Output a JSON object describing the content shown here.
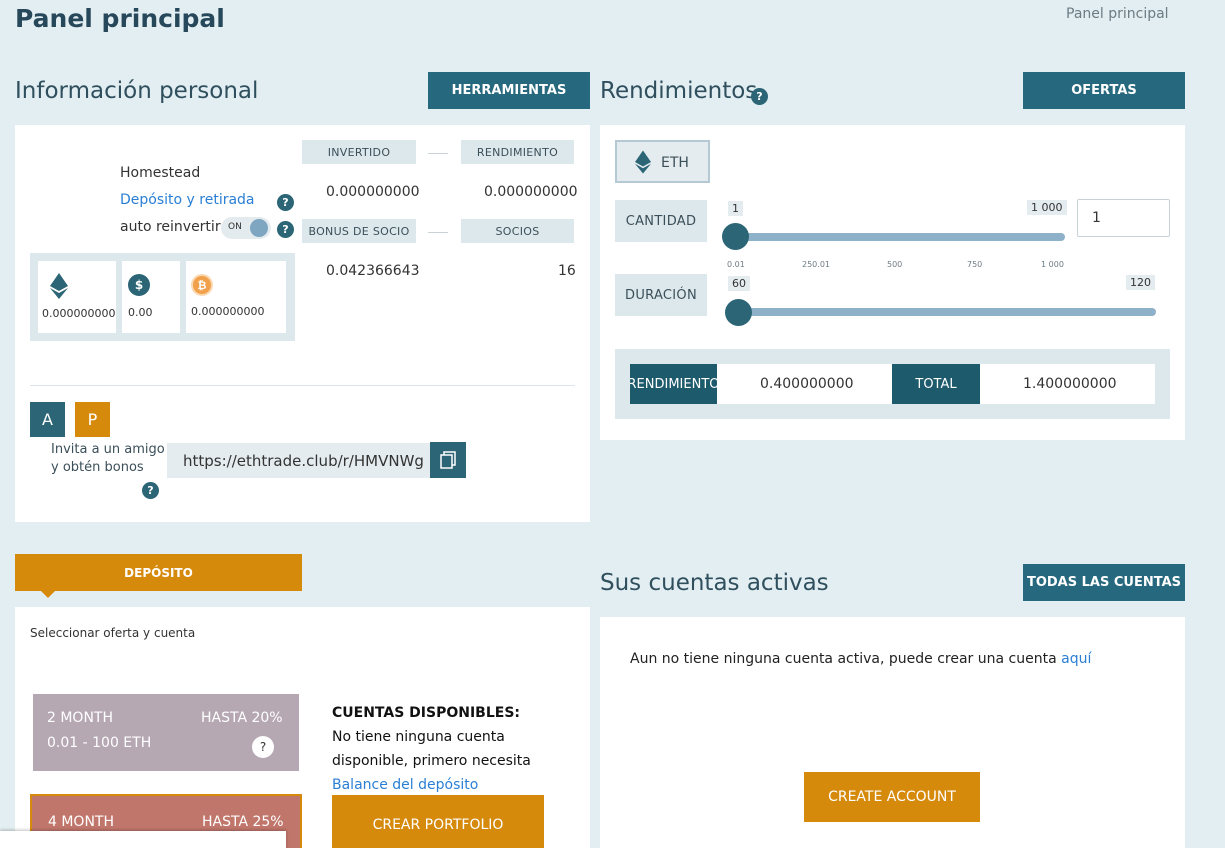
{
  "header": {
    "title": "Panel principal",
    "breadcrumb": "Panel principal"
  },
  "personal": {
    "title": "Información personal",
    "tools_button": "HERRAMIENTAS",
    "network": "Homestead",
    "deposit_link": "Depósito y retirada",
    "auto_reinvest_label": "auto reinvertir",
    "toggle_label": "ON",
    "invested_label": "INVERTIDO",
    "yield_label": "RENDIMIENTO",
    "invested_value": "0.000000000",
    "yield_value": "0.000000000",
    "partner_bonus_label": "BONUS DE SOCIO",
    "partners_label": "SOCIOS",
    "partner_bonus_value": "0.042366643",
    "partners_value": "16",
    "balances": {
      "eth": "0.000000000",
      "usd": "0.00",
      "btc": "0.000000000"
    },
    "avatar_a": "A",
    "avatar_p": "P",
    "invite_text_1": "Invita a un amigo",
    "invite_text_2": "y obtén bonos",
    "referral_url": "https://ethtrade.club/r/HMVNWg"
  },
  "returns": {
    "title": "Rendimientos",
    "offers_button": "OFERTAS",
    "currency": "ETH",
    "amount_label": "CANTIDAD",
    "amount_min_badge": "1",
    "amount_max_badge": "1 000",
    "amount_input": "1",
    "amount_ticks": [
      "0.01",
      "250.01",
      "500",
      "750",
      "1 000"
    ],
    "amount_fraction": 0,
    "duration_label": "DURACIÓN",
    "duration_min_badge": "60",
    "duration_max_badge": "120",
    "duration_fraction": 0,
    "result_yield_label": "RENDIMIENTO",
    "result_yield_value": "0.400000000",
    "total_label": "TOTAL",
    "total_value": "1.400000000"
  },
  "deposit": {
    "tab_label": "DEPÓSITO",
    "select_text": "Seleccionar oferta y cuenta",
    "plans": [
      {
        "name": "2 MONTH",
        "rate": "HASTA 20%",
        "range": "0.01 - 100 ETH",
        "color": "#b6a8b3"
      },
      {
        "name": "4 MONTH",
        "rate": "HASTA 25%",
        "color": "#c0766b"
      }
    ],
    "available_title": "CUENTAS DISPONIBLES:",
    "available_text_1": "No tiene ninguna cuenta",
    "available_text_2": "disponible, primero necesita",
    "balance_link": "Balance del depósito",
    "create_portfolio_button": "CREAR PORTFOLIO"
  },
  "accounts": {
    "title": "Sus cuentas activas",
    "all_button": "TODAS LAS CUENTAS",
    "empty_text": "Aun no tiene ninguna cuenta activa, puede crear una cuenta",
    "here_link": "aquí",
    "create_button": "CREATE ACCOUNT"
  },
  "colors": {
    "accent": "#26697e",
    "orange": "#d68a0c",
    "link": "#2a7fd4"
  }
}
